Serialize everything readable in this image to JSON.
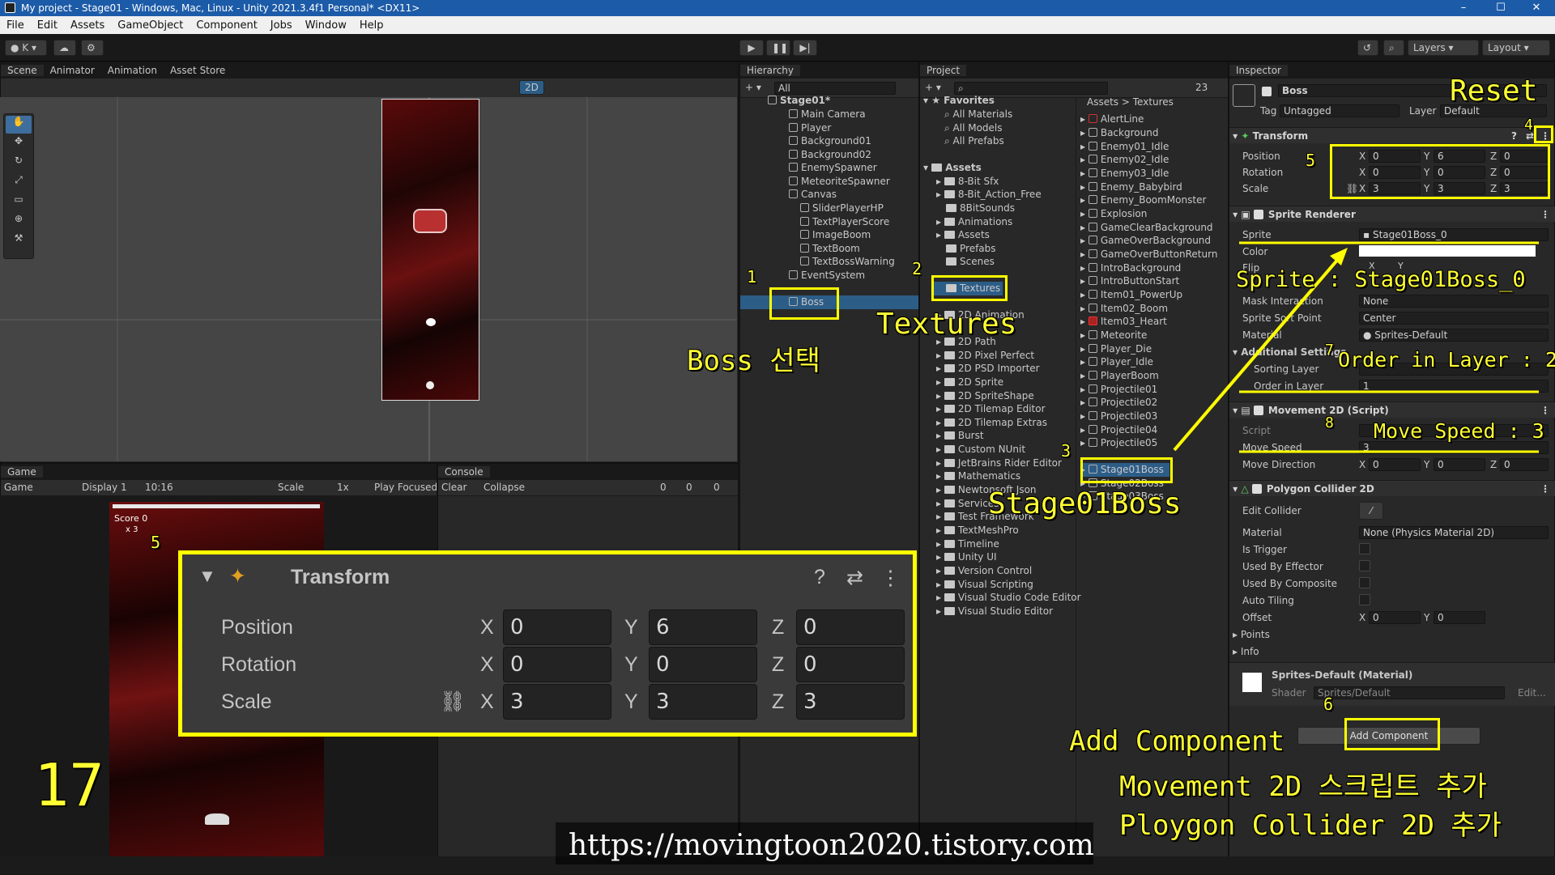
{
  "window": {
    "title": "My project - Stage01 - Windows, Mac, Linux - Unity 2021.3.4f1 Personal* <DX11>"
  },
  "menu": [
    "File",
    "Edit",
    "Assets",
    "GameObject",
    "Component",
    "Jobs",
    "Window",
    "Help"
  ],
  "toolbar": {
    "account": "K",
    "layers": "Layers",
    "layout": "Layout"
  },
  "scene": {
    "tabs": [
      "Scene",
      "Animator",
      "Animation",
      "Asset Store"
    ],
    "mode_2d": "2D"
  },
  "game": {
    "tab": "Game",
    "dropdown": "Game",
    "display": "Display 1",
    "aspect": "10:16",
    "scale_label": "Scale",
    "scale_value": "1x",
    "play_focused": "Play Focused",
    "score": "Score 0",
    "lives": "x 3"
  },
  "console": {
    "tab": "Console",
    "clear": "Clear",
    "collapse": "Collapse",
    "counts": [
      "0",
      "0",
      "0"
    ]
  },
  "hierarchy": {
    "tab": "Hierarchy",
    "search": "All",
    "scene": "Stage01*",
    "items": [
      "Main Camera",
      "Player",
      "Background01",
      "Background02",
      "EnemySpawner",
      "MeteoriteSpawner",
      "Canvas",
      "SliderPlayerHP",
      "TextPlayerScore",
      "ImageBoom",
      "TextBoom",
      "TextBossWarning",
      "EventSystem",
      "Boss"
    ]
  },
  "project": {
    "tab": "Project",
    "count": "23",
    "breadcrumb": [
      "Assets",
      "Textures"
    ],
    "favorites": {
      "label": "Favorites",
      "items": [
        "All Materials",
        "All Models",
        "All Prefabs"
      ]
    },
    "assets": {
      "label": "Assets",
      "items": [
        "8-Bit Sfx",
        "8-Bit_Action_Free",
        "8BitSounds",
        "Animations",
        "Assets",
        "Prefabs",
        "Scenes",
        "Textures"
      ]
    },
    "packages": [
      "2D Animation",
      "2D Path",
      "2D Pixel Perfect",
      "2D PSD Importer",
      "2D Sprite",
      "2D SpriteShape",
      "2D Tilemap Editor",
      "2D Tilemap Extras",
      "Burst",
      "Custom NUnit",
      "JetBrains Rider Editor",
      "Mathematics",
      "Newtonsoft Json",
      "Services",
      "Test Framework",
      "TextMeshPro",
      "Timeline",
      "Unity UI",
      "Version Control",
      "Visual Scripting",
      "Visual Studio Code Editor",
      "Visual Studio Editor"
    ],
    "textures": [
      "AlertLine",
      "Background",
      "Enemy01_Idle",
      "Enemy02_Idle",
      "Enemy03_Idle",
      "Enemy_Babybird",
      "Enemy_BoomMonster",
      "Explosion",
      "GameClearBackground",
      "GameOverBackground",
      "GameOverButtonReturn",
      "IntroBackground",
      "IntroButtonStart",
      "Item01_PowerUp",
      "Item02_Boom",
      "Item03_Heart",
      "Meteorite",
      "Player_Die",
      "Player_Idle",
      "PlayerBoom",
      "Projectile01",
      "Projectile02",
      "Projectile03",
      "Projectile04",
      "Projectile05",
      "Stage01Boss",
      "Stage02Boss",
      "Stage03Boss"
    ]
  },
  "inspector": {
    "tab": "Inspector",
    "object_name": "Boss",
    "tag_label": "Tag",
    "tag": "Untagged",
    "layer_label": "Layer",
    "layer": "Default",
    "transform": {
      "title": "Transform",
      "position_label": "Position",
      "rotation_label": "Rotation",
      "scale_label": "Scale",
      "position": [
        "0",
        "6",
        "0"
      ],
      "rotation": [
        "0",
        "0",
        "0"
      ],
      "scale": [
        "3",
        "3",
        "3"
      ]
    },
    "sprite_renderer": {
      "title": "Sprite Renderer",
      "sprite_label": "Sprite",
      "sprite": "Stage01Boss_0",
      "color_label": "Color",
      "flip_label": "Flip",
      "flip_x": "X",
      "flip_y": "Y",
      "mask_label": "Mask Interaction",
      "mask": "None",
      "sort_point_label": "Sprite Sort Point",
      "sort_point": "Center",
      "material_label": "Material",
      "material": "Sprites-Default",
      "additional": "Additional Settings",
      "sorting_layer_label": "Sorting Layer",
      "order_label": "Order in Layer",
      "order": "1"
    },
    "movement": {
      "title": "Movement 2D (Script)",
      "script_label": "Script",
      "speed_label": "Move Speed",
      "speed": "3",
      "direction_label": "Move Direction",
      "direction": [
        "0",
        "0",
        "0"
      ]
    },
    "collider": {
      "title": "Polygon Collider 2D",
      "edit_label": "Edit Collider",
      "material_label": "Material",
      "material": "None (Physics Material 2D)",
      "trigger": "Is Trigger",
      "effector": "Used By Effector",
      "composite": "Used By Composite",
      "tiling": "Auto Tiling",
      "offset_label": "Offset",
      "offset": [
        "0",
        "0"
      ],
      "points": "Points",
      "info": "Info"
    },
    "material_section": {
      "name": "Sprites-Default (Material)",
      "shader_label": "Shader",
      "shader": "Sprites/Default",
      "edit": "Edit..."
    },
    "add_component": "Add Component"
  },
  "annotations": {
    "n1": "1",
    "n2": "2",
    "n3": "3",
    "n4": "4",
    "n5": "5",
    "n5b": "5",
    "n6": "6",
    "n7": "7",
    "n8": "8",
    "boss": "Boss 선택",
    "textures": "Textures",
    "stage01boss": "Stage01Boss",
    "reset": "Reset",
    "sprite": "Sprite : Stage01Boss_0",
    "order": "Order in Layer : 2",
    "speed": "Move Speed : 3",
    "add1": "Add Component",
    "add2": "Movement 2D 스크립트 추가",
    "add3": "Ploygon Collider 2D 추가",
    "step": "17",
    "url": "https://movingtoon2020.tistory.com"
  },
  "colors": {
    "annotation": "#ffff00",
    "selection": "#2c5d87",
    "titlebar": "#1c5ba8"
  }
}
